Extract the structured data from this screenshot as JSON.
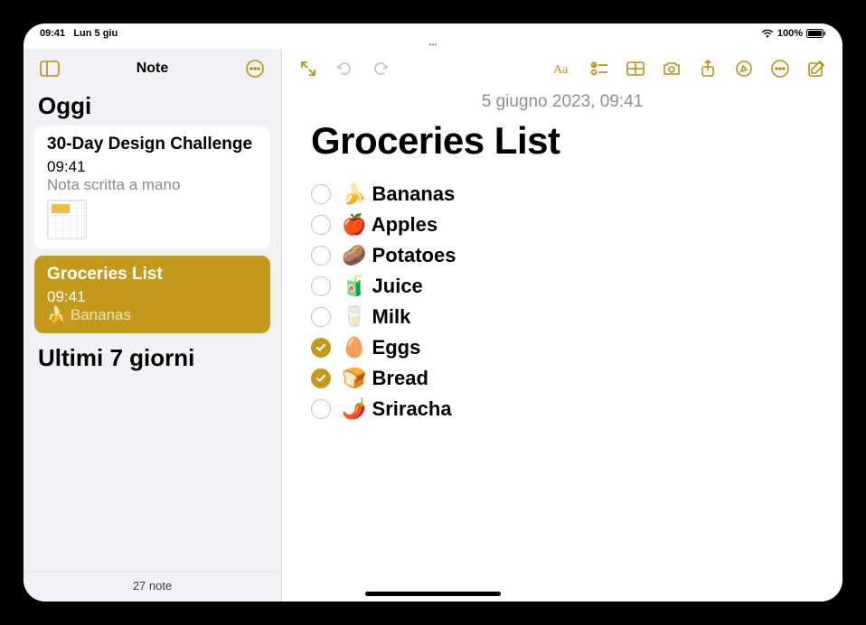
{
  "status": {
    "time": "09:41",
    "date": "Lun 5 giu",
    "battery": "100%"
  },
  "sidebar": {
    "title": "Note",
    "sections": {
      "today": "Oggi",
      "last7": "Ultimi 7 giorni"
    },
    "notes": [
      {
        "title": "30-Day Design Challenge",
        "time": "09:41",
        "snippet": "Nota scritta a mano"
      },
      {
        "title": "Groceries List",
        "time": "09:41",
        "snippet": "🍌 Bananas"
      }
    ],
    "footer": "27 note"
  },
  "note": {
    "date": "5 giugno 2023, 09:41",
    "title": "Groceries List",
    "items": [
      {
        "emoji": "🍌",
        "label": "Bananas",
        "checked": false
      },
      {
        "emoji": "🍎",
        "label": "Apples",
        "checked": false
      },
      {
        "emoji": "🥔",
        "label": "Potatoes",
        "checked": false
      },
      {
        "emoji": "🧃",
        "label": "Juice",
        "checked": false
      },
      {
        "emoji": "🥛",
        "label": "Milk",
        "checked": false
      },
      {
        "emoji": "🥚",
        "label": "Eggs",
        "checked": true
      },
      {
        "emoji": "🍞",
        "label": "Bread",
        "checked": true
      },
      {
        "emoji": "🌶️",
        "label": "Sriracha",
        "checked": false
      }
    ]
  }
}
